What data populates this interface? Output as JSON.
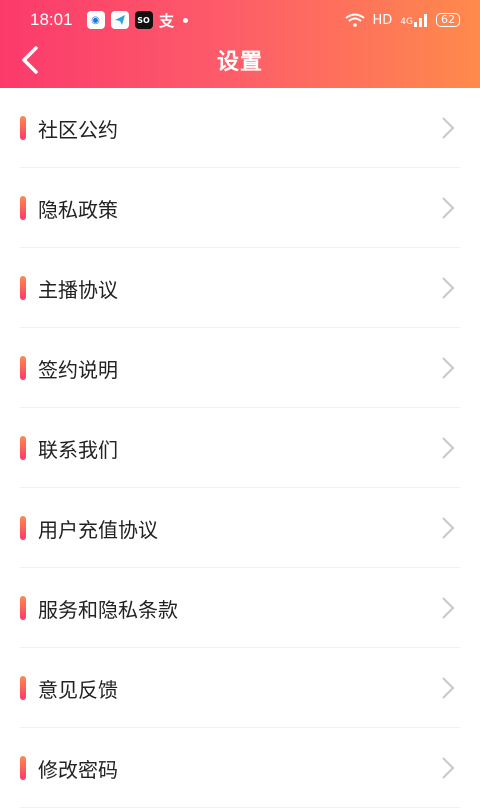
{
  "status_bar": {
    "time": "18:01",
    "notification_icons": [
      "ring-app-icon",
      "telegram-icon",
      "soul-app-icon",
      "alipay-icon"
    ],
    "so_label": "SO",
    "zhi_label": "支",
    "network_label": "HD",
    "signal_label": "4G",
    "battery": "62"
  },
  "header": {
    "title": "设置",
    "colors": {
      "start": "#fb3a6b",
      "end": "#ff8a4c"
    }
  },
  "menu": {
    "items": [
      {
        "label": "社区公约"
      },
      {
        "label": "隐私政策"
      },
      {
        "label": "主播协议"
      },
      {
        "label": "签约说明"
      },
      {
        "label": "联系我们"
      },
      {
        "label": "用户充值协议"
      },
      {
        "label": "服务和隐私条款"
      },
      {
        "label": "意见反馈"
      },
      {
        "label": "修改密码"
      }
    ]
  }
}
